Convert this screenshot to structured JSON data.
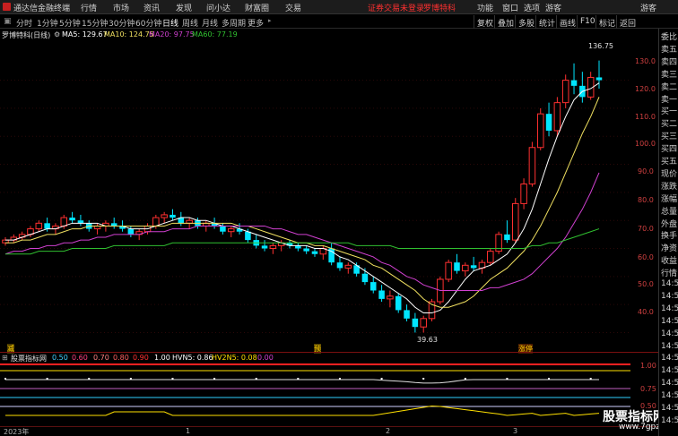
{
  "menu": {
    "app_name": "通达信金融终端",
    "items": [
      "行情",
      "市场",
      "资讯",
      "发现",
      "问小达",
      "财富圈",
      "交易"
    ],
    "warn": "证券交易未登录",
    "stock": "罗博特科",
    "right": [
      "功能",
      "窗口",
      "选项",
      "游客"
    ]
  },
  "periods": [
    "分时",
    "1分钟",
    "5分钟",
    "15分钟",
    "30分钟",
    "60分钟",
    "日线",
    "周线",
    "月线",
    "多周期",
    "更多"
  ],
  "active_period": "日线",
  "toolbar_right": [
    "复权",
    "叠加",
    "多股",
    "统计",
    "画线",
    "F10",
    "标记",
    "返回"
  ],
  "info": {
    "name": "罗博特科(日线)",
    "ma5": "MA5: 129.67",
    "ma10": "MA10: 124.75",
    "ma20": "MA20: 97.75",
    "ma60": "MA60: 77.19"
  },
  "price_axis": [
    "130.0",
    "120.0",
    "110.0",
    "100.0",
    "90.0",
    "80.0",
    "70.0",
    "60.0",
    "50.0",
    "40.0"
  ],
  "annotations": {
    "high": "136.75",
    "low": "39.63",
    "tag1": "减",
    "tag2": "预",
    "tag3": "涨停"
  },
  "indicator": {
    "name": "股票指标网",
    "values": [
      "0.50",
      "0.60",
      "0.70",
      "0.80",
      "0.90",
      "1.00",
      "HVN5: 0.86",
      "HV2N5: 0.08",
      "0.00"
    ],
    "axis": [
      "1.00",
      "0.75",
      "0.50"
    ]
  },
  "dates": [
    "2023年",
    "1",
    "2",
    "3"
  ],
  "sidebar": [
    "委比",
    "卖五",
    "卖四",
    "卖三",
    "卖二",
    "卖一",
    "买一",
    "买二",
    "买三",
    "买四",
    "买五",
    "现价",
    "涨跌",
    "涨幅",
    "总量",
    "外盘",
    "换手",
    "净资",
    "收益",
    "行情",
    "14:50",
    "14:50",
    "14:50",
    "14:50",
    "14:50",
    "14:50",
    "14:50",
    "14:50",
    "14:50",
    "14:50",
    "14:50",
    "14:50"
  ],
  "watermark": {
    "title": "股票指标网",
    "url": "www.7gpzb.com"
  },
  "colors": {
    "up": "#ff3030",
    "down": "#00e5ff",
    "ma5": "#ffffff",
    "ma10": "#f0e060",
    "ma20": "#d040d0",
    "ma60": "#30c030"
  },
  "chart_data": {
    "type": "candlestick",
    "ylim": [
      36,
      142
    ],
    "candles": [
      [
        72,
        74,
        71,
        73
      ],
      [
        73,
        75,
        72,
        74
      ],
      [
        74,
        76,
        73,
        75
      ],
      [
        75,
        78,
        74,
        77
      ],
      [
        77,
        80,
        76,
        79
      ],
      [
        79,
        81,
        76,
        77
      ],
      [
        77,
        79,
        75,
        78
      ],
      [
        78,
        82,
        77,
        81
      ],
      [
        81,
        83,
        79,
        80
      ],
      [
        80,
        82,
        78,
        79
      ],
      [
        79,
        80,
        76,
        77
      ],
      [
        77,
        79,
        75,
        78
      ],
      [
        78,
        80,
        76,
        79
      ],
      [
        79,
        81,
        77,
        78
      ],
      [
        78,
        80,
        76,
        77
      ],
      [
        77,
        78,
        74,
        75
      ],
      [
        75,
        77,
        73,
        76
      ],
      [
        76,
        79,
        75,
        78
      ],
      [
        78,
        82,
        77,
        81
      ],
      [
        81,
        83,
        79,
        82
      ],
      [
        82,
        84,
        80,
        81
      ],
      [
        81,
        83,
        78,
        79
      ],
      [
        79,
        81,
        77,
        80
      ],
      [
        80,
        81,
        77,
        78
      ],
      [
        78,
        80,
        76,
        79
      ],
      [
        79,
        81,
        77,
        78
      ],
      [
        78,
        79,
        75,
        76
      ],
      [
        76,
        78,
        74,
        77
      ],
      [
        77,
        79,
        75,
        76
      ],
      [
        76,
        77,
        72,
        73
      ],
      [
        73,
        75,
        70,
        71
      ],
      [
        71,
        73,
        69,
        70
      ],
      [
        70,
        72,
        68,
        71
      ],
      [
        71,
        73,
        69,
        72
      ],
      [
        72,
        73,
        70,
        71
      ],
      [
        71,
        72,
        69,
        70
      ],
      [
        70,
        71,
        68,
        69
      ],
      [
        69,
        70,
        67,
        68
      ],
      [
        68,
        71,
        66,
        70
      ],
      [
        70,
        72,
        64,
        65
      ],
      [
        65,
        67,
        62,
        63
      ],
      [
        63,
        65,
        61,
        64
      ],
      [
        64,
        65,
        60,
        61
      ],
      [
        61,
        63,
        57,
        58
      ],
      [
        58,
        60,
        54,
        55
      ],
      [
        55,
        57,
        51,
        52
      ],
      [
        52,
        55,
        49,
        53
      ],
      [
        53,
        54,
        47,
        48
      ],
      [
        48,
        50,
        44,
        45
      ],
      [
        45,
        47,
        40,
        42
      ],
      [
        42,
        46,
        40,
        45
      ],
      [
        45,
        52,
        44,
        51
      ],
      [
        51,
        60,
        50,
        59
      ],
      [
        59,
        66,
        58,
        65
      ],
      [
        65,
        68,
        61,
        62
      ],
      [
        62,
        65,
        60,
        64
      ],
      [
        64,
        67,
        62,
        63
      ],
      [
        63,
        66,
        61,
        65
      ],
      [
        65,
        70,
        64,
        69
      ],
      [
        69,
        76,
        68,
        75
      ],
      [
        75,
        80,
        72,
        73
      ],
      [
        73,
        88,
        72,
        86
      ],
      [
        86,
        95,
        84,
        93
      ],
      [
        93,
        108,
        92,
        106
      ],
      [
        106,
        120,
        105,
        118
      ],
      [
        118,
        122,
        110,
        112
      ],
      [
        112,
        124,
        110,
        122
      ],
      [
        122,
        132,
        120,
        130
      ],
      [
        130,
        136,
        125,
        128
      ],
      [
        128,
        133,
        122,
        124
      ],
      [
        124,
        133,
        123,
        131
      ],
      [
        131,
        137,
        127,
        130
      ]
    ],
    "ma": {
      "MA5": [
        73,
        73,
        74,
        75,
        76,
        77,
        77,
        78,
        79,
        79,
        79,
        79,
        78,
        78,
        78,
        77,
        77,
        77,
        78,
        79,
        80,
        81,
        81,
        80,
        80,
        79,
        78,
        78,
        77,
        76,
        75,
        74,
        73,
        72,
        71,
        71,
        71,
        70,
        70,
        69,
        67,
        66,
        64,
        62,
        60,
        58,
        56,
        54,
        52,
        49,
        47,
        47,
        48,
        51,
        55,
        59,
        62,
        63,
        64,
        66,
        68,
        72,
        77,
        84,
        93,
        102,
        110,
        117,
        123,
        126,
        127,
        129
      ],
      "MA10": [
        72,
        72,
        73,
        73,
        74,
        75,
        75,
        76,
        77,
        77,
        78,
        78,
        78,
        78,
        78,
        78,
        78,
        78,
        78,
        78,
        79,
        79,
        79,
        79,
        79,
        79,
        79,
        79,
        78,
        78,
        77,
        76,
        75,
        74,
        73,
        72,
        72,
        71,
        71,
        70,
        69,
        68,
        67,
        66,
        64,
        63,
        61,
        59,
        57,
        55,
        52,
        50,
        49,
        49,
        50,
        51,
        53,
        56,
        59,
        61,
        63,
        66,
        69,
        73,
        78,
        84,
        90,
        97,
        104,
        111,
        117,
        124
      ],
      "MA20": [
        68,
        69,
        69,
        70,
        70,
        71,
        71,
        72,
        72,
        73,
        73,
        74,
        74,
        75,
        75,
        75,
        75,
        76,
        76,
        76,
        77,
        77,
        77,
        78,
        78,
        78,
        78,
        78,
        78,
        78,
        78,
        78,
        77,
        77,
        76,
        75,
        75,
        74,
        73,
        72,
        71,
        70,
        69,
        68,
        67,
        65,
        64,
        62,
        60,
        59,
        57,
        56,
        55,
        55,
        55,
        55,
        55,
        55,
        56,
        56,
        57,
        58,
        59,
        61,
        64,
        67,
        70,
        74,
        79,
        84,
        90,
        97
      ],
      "MA60": [
        68,
        68,
        68,
        68,
        69,
        69,
        69,
        69,
        70,
        70,
        70,
        70,
        70,
        71,
        71,
        71,
        71,
        71,
        71,
        71,
        72,
        72,
        72,
        72,
        72,
        72,
        72,
        72,
        72,
        72,
        72,
        72,
        72,
        72,
        72,
        72,
        72,
        72,
        72,
        72,
        72,
        72,
        71,
        71,
        71,
        71,
        71,
        70,
        70,
        70,
        70,
        70,
        70,
        70,
        70,
        70,
        70,
        70,
        70,
        70,
        70,
        70,
        70,
        71,
        71,
        72,
        72,
        73,
        74,
        75,
        76,
        77
      ]
    }
  }
}
